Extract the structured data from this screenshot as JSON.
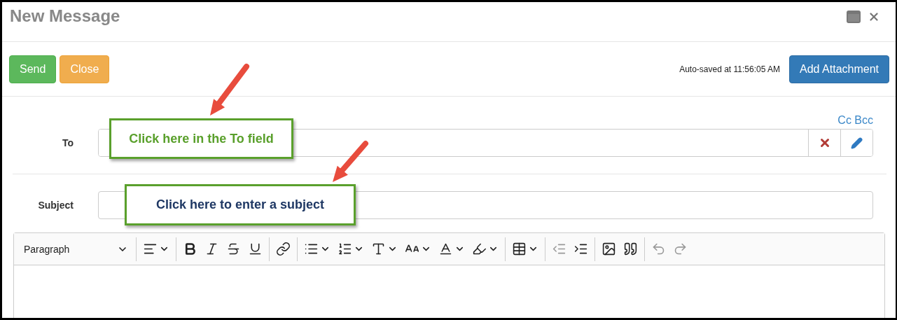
{
  "window": {
    "title": "New Message"
  },
  "actions": [
    {
      "label": "Send",
      "kind": "success"
    },
    {
      "label": "Close",
      "kind": "warning"
    }
  ],
  "autosave": "Auto-saved at 11:56:05 AM",
  "attach_button": "Add Attachment",
  "cc_bcc": "Cc Bcc",
  "fields": [
    {
      "label": "To",
      "kind": "recipients"
    },
    {
      "label": "Subject",
      "kind": "text"
    }
  ],
  "editor": {
    "block_format": "Paragraph",
    "toolbar": [
      {
        "tools": [
          {
            "kind": "align",
            "menu": true,
            "disabled": false
          }
        ]
      },
      {
        "tools": [
          {
            "kind": "bold",
            "menu": false,
            "disabled": false
          },
          {
            "kind": "italic",
            "menu": false,
            "disabled": false
          },
          {
            "kind": "strikethrough",
            "menu": false,
            "disabled": false
          },
          {
            "kind": "underline",
            "menu": false,
            "disabled": false
          }
        ]
      },
      {
        "tools": [
          {
            "kind": "link",
            "menu": false,
            "disabled": false
          }
        ]
      },
      {
        "tools": [
          {
            "kind": "bullets",
            "menu": true,
            "disabled": false
          },
          {
            "kind": "numbers",
            "menu": true,
            "disabled": false
          },
          {
            "kind": "font-family",
            "menu": true,
            "disabled": false
          },
          {
            "kind": "font-size",
            "menu": true,
            "disabled": false
          },
          {
            "kind": "font-color",
            "menu": true,
            "disabled": false
          },
          {
            "kind": "highlight",
            "menu": true,
            "disabled": false
          }
        ]
      },
      {
        "tools": [
          {
            "kind": "table",
            "menu": true,
            "disabled": false
          }
        ]
      },
      {
        "tools": [
          {
            "kind": "outdent",
            "menu": false,
            "disabled": true
          },
          {
            "kind": "indent",
            "menu": false,
            "disabled": false
          }
        ]
      },
      {
        "tools": [
          {
            "kind": "image",
            "menu": false,
            "disabled": false
          },
          {
            "kind": "quote",
            "menu": false,
            "disabled": false
          }
        ]
      },
      {
        "tools": [
          {
            "kind": "undo",
            "menu": false,
            "disabled": true
          },
          {
            "kind": "redo",
            "menu": false,
            "disabled": true
          }
        ]
      }
    ]
  },
  "callouts": [
    {
      "text": "Click here in the To field",
      "color": "#5aa02c"
    },
    {
      "text": "Click here to enter a subject",
      "color": "#1f3864"
    }
  ]
}
